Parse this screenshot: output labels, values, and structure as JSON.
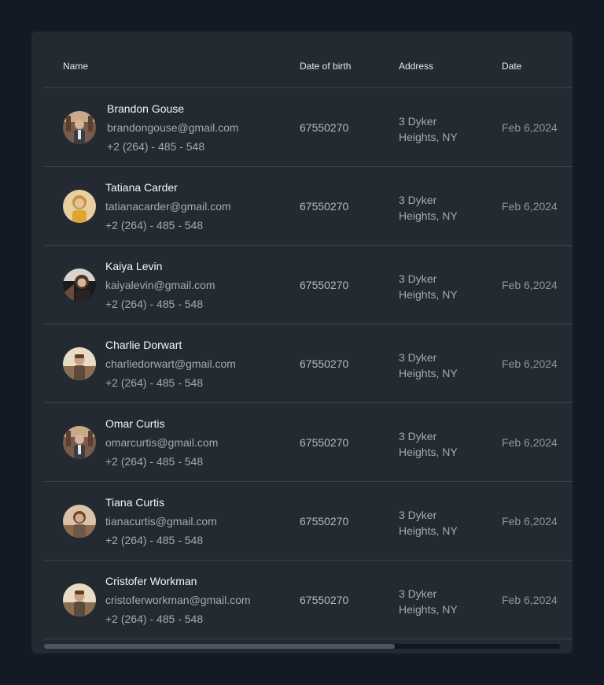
{
  "table": {
    "columns": {
      "name": "Name",
      "dob": "Date of birth",
      "address": "Address",
      "date": "Date"
    },
    "rows": [
      {
        "name": "Brandon Gouse",
        "email": "brandongouse@gmail.com",
        "phone": "+2 (264) - 485 - 548",
        "dob": "67550270",
        "address_line1": "3 Dyker",
        "address_line2": "Heights, NY",
        "date": "Feb 6,2024"
      },
      {
        "name": "Tatiana Carder",
        "email": "tatianacarder@gmail.com",
        "phone": "+2 (264) - 485 - 548",
        "dob": "67550270",
        "address_line1": "3 Dyker",
        "address_line2": "Heights, NY",
        "date": "Feb 6,2024"
      },
      {
        "name": "Kaiya Levin",
        "email": "kaiyalevin@gmail.com",
        "phone": "+2 (264) - 485 - 548",
        "dob": "67550270",
        "address_line1": "3 Dyker",
        "address_line2": "Heights, NY",
        "date": "Feb 6,2024"
      },
      {
        "name": "Charlie Dorwart",
        "email": "charliedorwart@gmail.com",
        "phone": "+2 (264) - 485 - 548",
        "dob": "67550270",
        "address_line1": "3 Dyker",
        "address_line2": "Heights, NY",
        "date": "Feb 6,2024"
      },
      {
        "name": "Omar Curtis",
        "email": "omarcurtis@gmail.com",
        "phone": "+2 (264) - 485 - 548",
        "dob": "67550270",
        "address_line1": "3 Dyker",
        "address_line2": "Heights, NY",
        "date": "Feb 6,2024"
      },
      {
        "name": "Tiana Curtis",
        "email": "tianacurtis@gmail.com",
        "phone": "+2 (264) - 485 - 548",
        "dob": "67550270",
        "address_line1": "3 Dyker",
        "address_line2": "Heights, NY",
        "date": "Feb 6,2024"
      },
      {
        "name": "Cristofer Workman",
        "email": "cristoferworkman@gmail.com",
        "phone": "+2 (264) - 485 - 548",
        "dob": "67550270",
        "address_line1": "3 Dyker",
        "address_line2": "Heights, NY",
        "date": "Feb 6,2024"
      }
    ]
  },
  "scrollbar": {
    "visible_fraction": 0.68
  },
  "colors": {
    "page_background": "#131a26",
    "card_background": "#232a31",
    "divider": "#3b434b",
    "primary_text": "#f4f6f8",
    "secondary_text": "#a3aab3"
  }
}
